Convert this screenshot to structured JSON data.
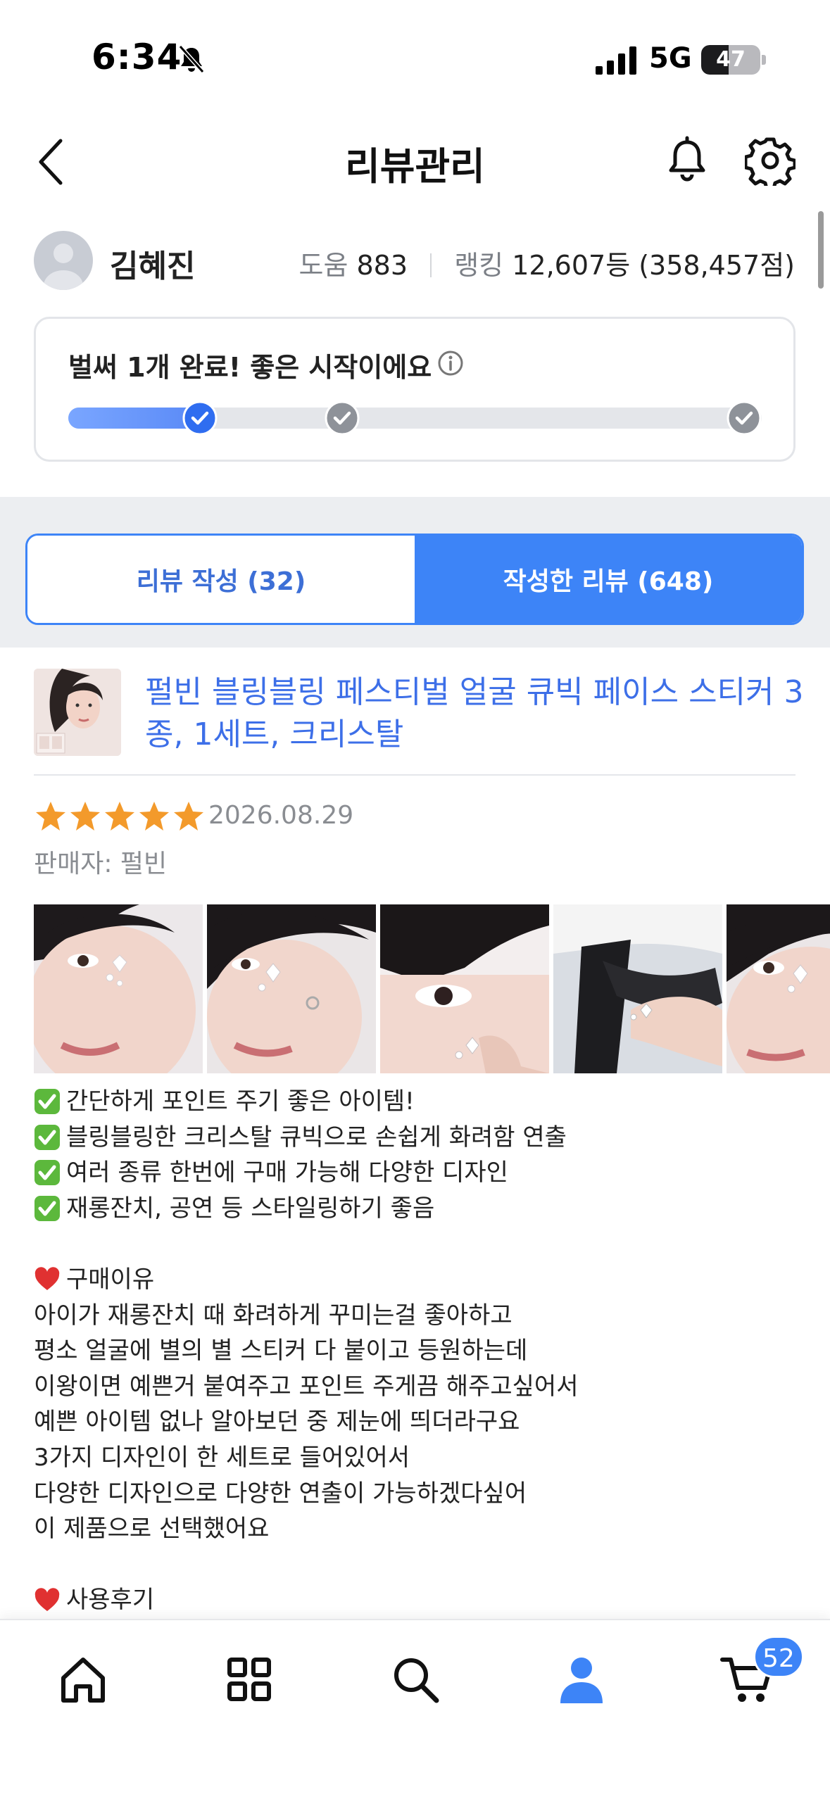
{
  "status_bar": {
    "time": "6:34",
    "network": "5G",
    "battery_percent": "47",
    "battery_level": 0.47,
    "icons": [
      "bell-slash-icon",
      "signal-bars-icon",
      "battery-icon"
    ]
  },
  "header": {
    "title": "리뷰관리",
    "icons": [
      "chevron-left-icon",
      "bell-icon",
      "gear-icon"
    ]
  },
  "profile": {
    "name": "김혜진",
    "help_label": "도움",
    "help_count": "883",
    "ranking_label": "랭킹",
    "ranking_value": "12,607등 (358,457점)"
  },
  "progress": {
    "message": "벌써 1개 완료! 좋은 시작이에요",
    "completed_steps": 1,
    "total_steps": 3,
    "fill_fraction": 0.19,
    "colors": {
      "fill": "#5a8af7",
      "done_step": "#2f6df0",
      "todo_step": "#8e9299"
    }
  },
  "tabs": [
    {
      "label": "리뷰 작성 (32)",
      "active": false
    },
    {
      "label": "작성한 리뷰 (648)",
      "active": true
    }
  ],
  "review": {
    "product_title": "펄빈 블링블링 페스티벌 얼굴 큐빅 페이스 스티커 3종, 1세트, 크리스탈",
    "rating": 5,
    "max_rating": 5,
    "date": "2026.08.29",
    "seller": "판매자: 펄빈",
    "photo_count_visible": 5,
    "lines": [
      {
        "mark": "check",
        "text": "간단하게 포인트 주기 좋은 아이템!"
      },
      {
        "mark": "check",
        "text": "블링블링한 크리스탈 큐빅으로 손쉽게 화려함 연출"
      },
      {
        "mark": "check",
        "text": "여러 종류 한번에 구매 가능해 다양한 디자인"
      },
      {
        "mark": "check",
        "text": "재롱잔치, 공연 등 스타일링하기 좋음"
      },
      {
        "mark": "",
        "text": ""
      },
      {
        "mark": "heart",
        "text": "구매이유"
      },
      {
        "mark": "",
        "text": "아이가 재롱잔치 때 화려하게 꾸미는걸 좋아하고"
      },
      {
        "mark": "",
        "text": "평소 얼굴에 별의 별 스티커 다 붙이고 등원하는데"
      },
      {
        "mark": "",
        "text": "이왕이면 예쁜거 붙여주고 포인트 주게끔 해주고싶어서"
      },
      {
        "mark": "",
        "text": "예쁜 아이템 없나 알아보던 중 제눈에 띄더라구요"
      },
      {
        "mark": "",
        "text": "3가지 디자인이 한 세트로 들어있어서"
      },
      {
        "mark": "",
        "text": "다양한 디자인으로 다양한 연출이 가능하겠다싶어"
      },
      {
        "mark": "",
        "text": "이 제품으로 선택했어요"
      },
      {
        "mark": "",
        "text": ""
      },
      {
        "mark": "heart",
        "text": "사용후기"
      }
    ]
  },
  "bottom_nav": {
    "items": [
      "home-icon",
      "grid-icon",
      "search-icon",
      "person-icon",
      "cart-icon"
    ],
    "active": "person-icon",
    "cart_badge": "52",
    "colors": {
      "active": "#3d84f7",
      "inactive": "#111111"
    }
  }
}
